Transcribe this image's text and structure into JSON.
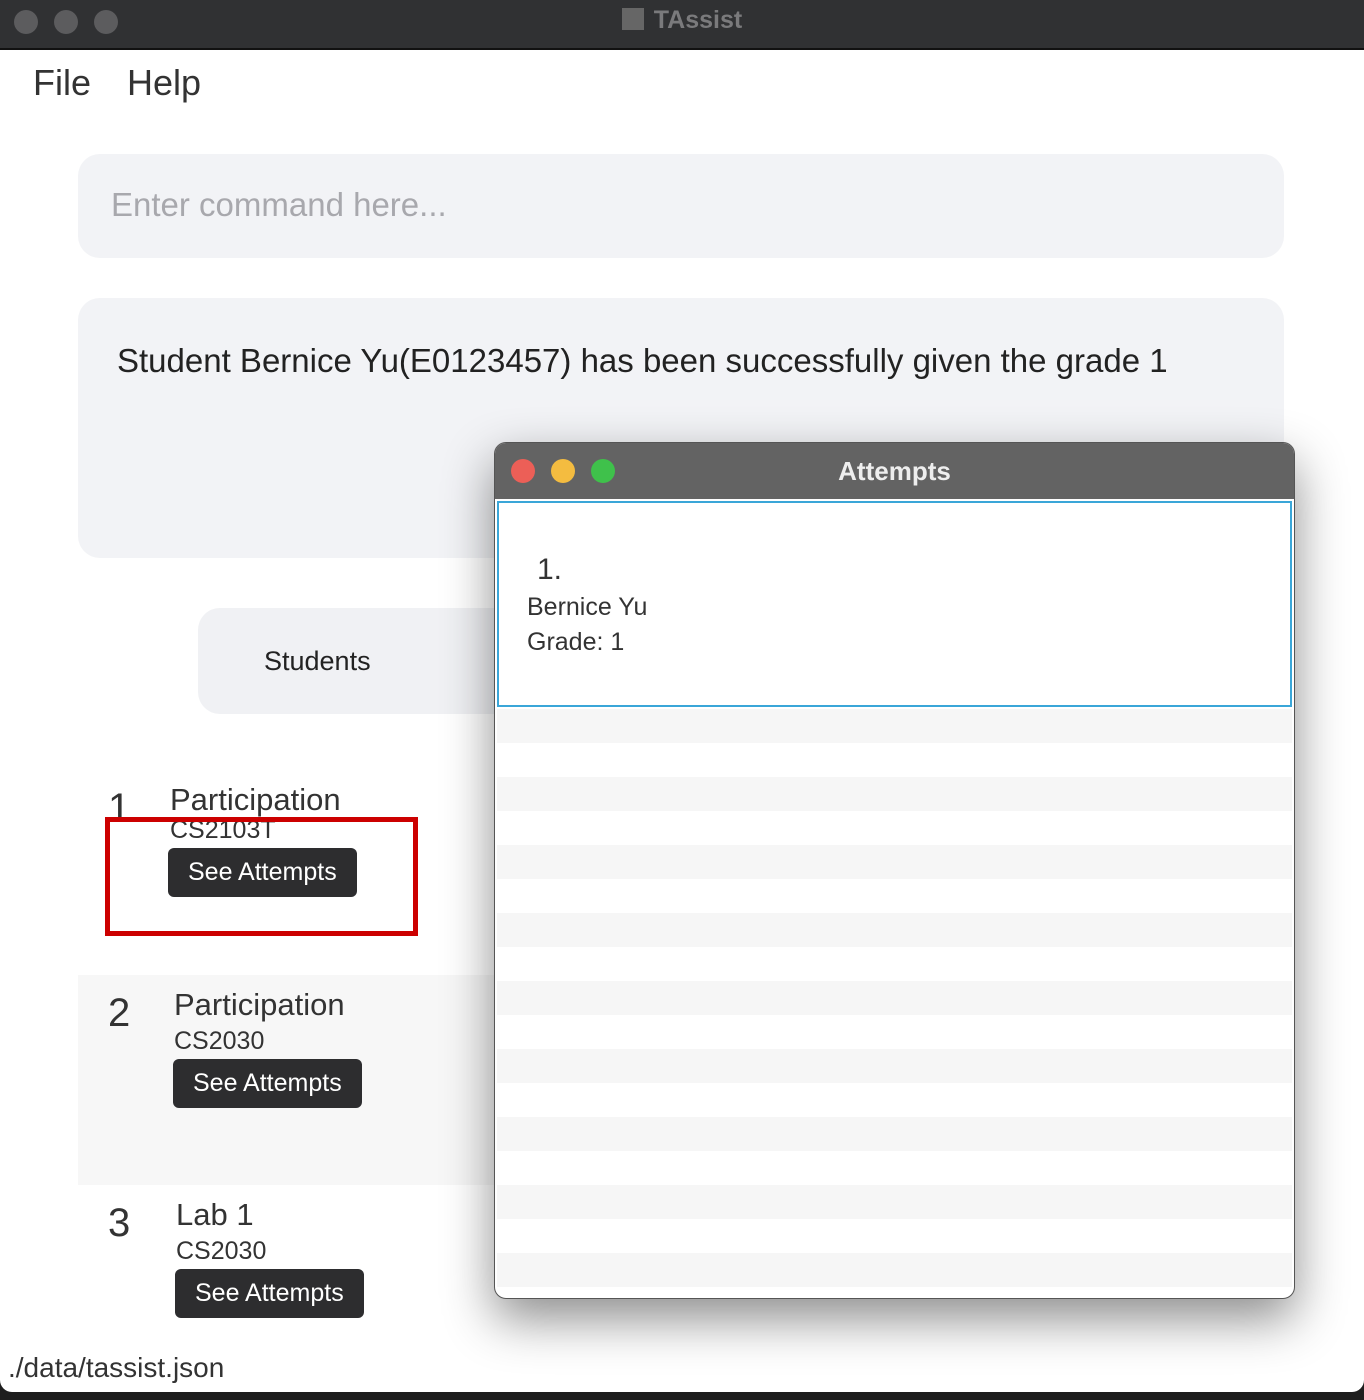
{
  "window": {
    "title": "TAssist"
  },
  "menu": [
    "File",
    "Help"
  ],
  "command": {
    "placeholder": "Enter command here..."
  },
  "result": "Student Bernice Yu(E0123457) has been successfully given the grade 1",
  "tab": "Students",
  "assessments": [
    {
      "index": "1",
      "name": "Participation",
      "module": "CS2103T",
      "button": "See Attempts"
    },
    {
      "index": "2",
      "name": "Participation",
      "module": "CS2030",
      "button": "See Attempts"
    },
    {
      "index": "3",
      "name": "Lab 1",
      "module": "CS2030",
      "button": "See Attempts"
    }
  ],
  "status": "./data/tassist.json",
  "popup": {
    "title": "Attempts",
    "items": [
      {
        "index": "1.",
        "name": "Bernice Yu",
        "grade": "Grade: 1"
      }
    ]
  }
}
